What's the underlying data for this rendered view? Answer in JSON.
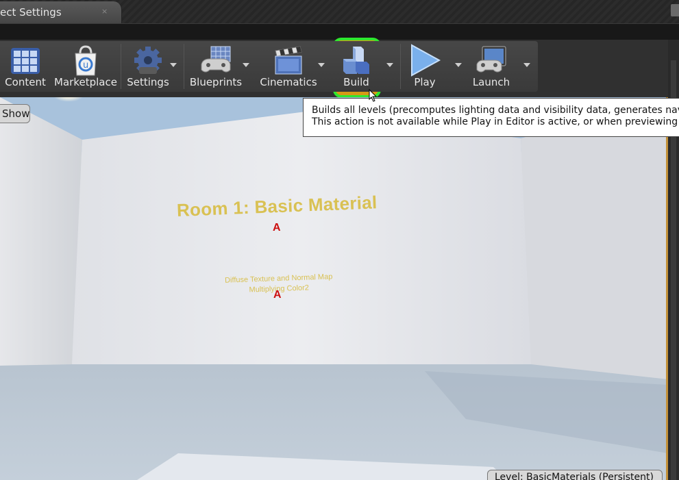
{
  "tab": {
    "title": "ect Settings",
    "close_label": "×"
  },
  "toolbar": {
    "buttons": [
      {
        "label": "Content",
        "icon": "content-grid-icon"
      },
      {
        "label": "Marketplace",
        "icon": "marketplace-bag-icon"
      },
      {
        "label": "Settings",
        "icon": "settings-gear-icon"
      },
      {
        "label": "Blueprints",
        "icon": "blueprints-gamepad-icon"
      },
      {
        "label": "Cinematics",
        "icon": "cinematics-clapper-icon"
      },
      {
        "label": "Build",
        "icon": "build-blocks-icon"
      },
      {
        "label": "Play",
        "icon": "play-triangle-icon"
      },
      {
        "label": "Launch",
        "icon": "launch-monitor-icon"
      }
    ],
    "highlight_color": "#2ee82e",
    "build_bg": "#d69a16"
  },
  "tooltip": {
    "line1": "Builds all levels (precomputes lighting data and visibility data, generates nav",
    "line2": "This action is not available while Play in Editor is active, or when previewing l"
  },
  "viewport": {
    "show_label": "Show",
    "level_label": "Level:  BasicMaterials (Persistent)",
    "room_title": "Room 1: Basic Material",
    "room_sub_line1": "Diffuse Texture and Normal Map",
    "room_sub_line2": "Multiplying Color2",
    "marker_glyph": "A"
  }
}
